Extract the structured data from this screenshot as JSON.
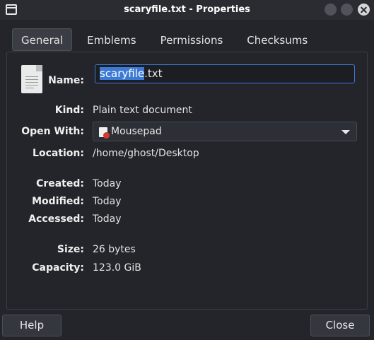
{
  "window": {
    "title": "scaryfile.txt - Properties",
    "app_icon": "window-icon",
    "controls": [
      "minimize-button",
      "maximize-button",
      "close-button"
    ]
  },
  "tabs": [
    {
      "label": "General",
      "active": true
    },
    {
      "label": "Emblems",
      "active": false
    },
    {
      "label": "Permissions",
      "active": false
    },
    {
      "label": "Checksums",
      "active": false
    }
  ],
  "general": {
    "file_icon": "text-file-icon",
    "name_label": "Name:",
    "name_value_selected": "scaryfile",
    "name_value_rest": ".txt",
    "kind_label": "Kind:",
    "kind_value": "Plain text document",
    "open_with_label": "Open With:",
    "open_with_value": "Mousepad",
    "open_with_icon": "mousepad-icon",
    "location_label": "Location:",
    "location_value": "/home/ghost/Desktop",
    "created_label": "Created:",
    "created_value": "Today",
    "modified_label": "Modified:",
    "modified_value": "Today",
    "accessed_label": "Accessed:",
    "accessed_value": "Today",
    "size_label": "Size:",
    "size_value": "26 bytes",
    "capacity_label": "Capacity:",
    "capacity_value": "123.0 GiB"
  },
  "buttons": {
    "help": "Help",
    "close": "Close"
  },
  "colors": {
    "background": "#23252b",
    "accent": "#3d7ad6",
    "text": "#e6e6e6"
  }
}
